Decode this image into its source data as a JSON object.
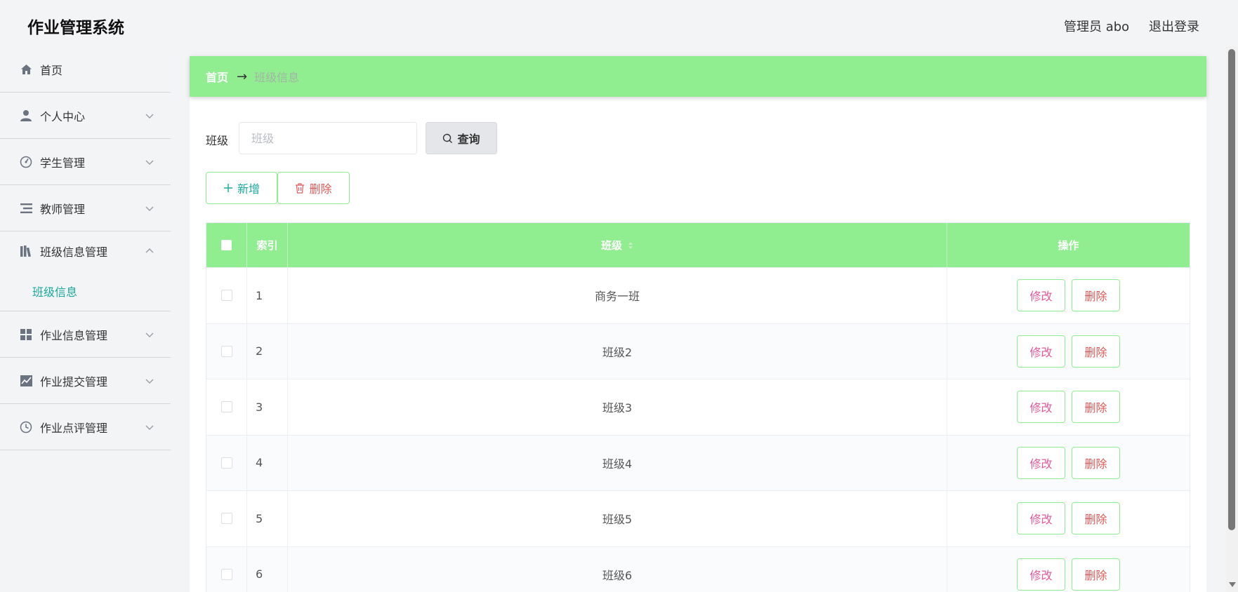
{
  "header": {
    "title": "作业管理系统",
    "user": "管理员 abo",
    "logout": "退出登录"
  },
  "sidebar": {
    "items": [
      {
        "label": "首页",
        "icon": "home-icon"
      },
      {
        "label": "个人中心",
        "icon": "user-icon"
      },
      {
        "label": "学生管理",
        "icon": "gauge-icon"
      },
      {
        "label": "教师管理",
        "icon": "list-icon"
      },
      {
        "label": "班级信息管理",
        "icon": "books-icon",
        "expanded": true
      },
      {
        "label": "作业信息管理",
        "icon": "grid-icon"
      },
      {
        "label": "作业提交管理",
        "icon": "chart-icon"
      },
      {
        "label": "作业点评管理",
        "icon": "clock-icon"
      }
    ],
    "sub_item": "班级信息"
  },
  "breadcrumb": {
    "home": "首页",
    "current": "班级信息"
  },
  "search": {
    "label": "班级",
    "placeholder": "班级",
    "button": "查询"
  },
  "actions": {
    "add": "新增",
    "delete": "删除"
  },
  "table": {
    "headers": {
      "index": "索引",
      "class": "班级",
      "operation": "操作"
    },
    "rows": [
      {
        "index": "1",
        "class": "商务一班"
      },
      {
        "index": "2",
        "class": "班级2"
      },
      {
        "index": "3",
        "class": "班级3"
      },
      {
        "index": "4",
        "class": "班级4"
      },
      {
        "index": "5",
        "class": "班级5"
      },
      {
        "index": "6",
        "class": "班级6"
      }
    ],
    "edit_label": "修改",
    "delete_label": "删除"
  },
  "colors": {
    "accent_green": "#90ee90",
    "teal_text": "#1aa89c",
    "edit_pink": "#e25a9a",
    "delete_red": "#e05a5a"
  }
}
